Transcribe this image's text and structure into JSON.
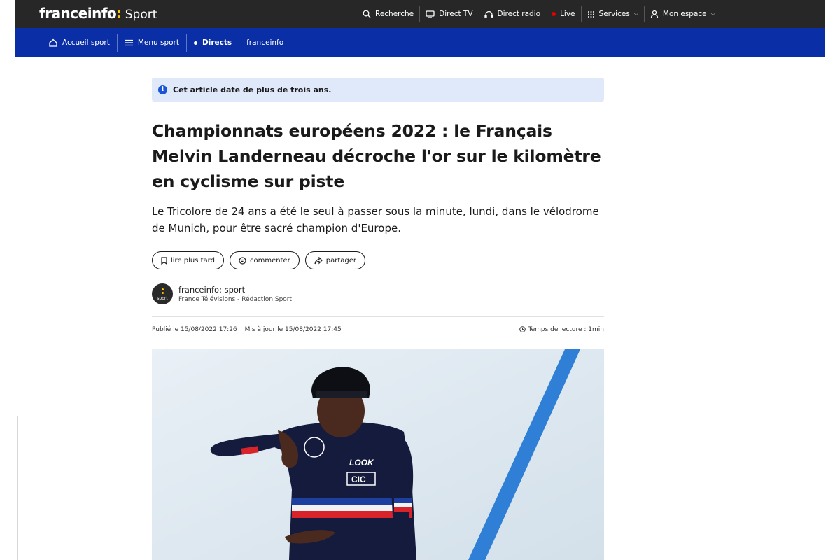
{
  "header": {
    "brand": "franceinfo",
    "brand_colon": ":",
    "section": "Sport",
    "nav": [
      {
        "label": "Recherche",
        "icon": "search-icon"
      },
      {
        "label": "Direct TV",
        "icon": "tv-icon"
      },
      {
        "label": "Direct radio",
        "icon": "headphones-icon"
      },
      {
        "label": "Live",
        "icon": "live-dot-icon"
      },
      {
        "label": "Services",
        "icon": "grid-icon"
      },
      {
        "label": "Mon espace",
        "icon": "user-icon"
      }
    ]
  },
  "subnav": {
    "items": [
      {
        "label": "Accueil sport",
        "icon": "home-icon"
      },
      {
        "label": "Menu sport",
        "icon": "menu-icon"
      },
      {
        "label": "Directs",
        "icon": "dot-icon"
      },
      {
        "label": "franceinfo"
      }
    ]
  },
  "notice": {
    "text": "Cet article date de plus de trois ans.",
    "icon": "info-icon"
  },
  "article": {
    "title": "Championnats européens 2022 : le Français Melvin Landerneau décroche l'or sur le kilomètre en cyclisme sur piste",
    "lead": "Le Tricolore de 24 ans a été le seul à passer sous la minute, lundi, dans le vélodrome de Munich, pour être sacré champion d'Europe.",
    "actions": [
      {
        "label": "lire plus tard",
        "icon": "bookmark-icon"
      },
      {
        "label": "commenter",
        "icon": "comment-icon"
      },
      {
        "label": "partager",
        "icon": "share-icon"
      }
    ],
    "author": {
      "name": "franceinfo: sport",
      "org": "France Télévisions - Rédaction Sport",
      "avatar_tag": "sport"
    },
    "published": "Publié le 15/08/2022 17:26",
    "updated": "Mis à jour le 15/08/2022 17:45",
    "reading_time": "Temps de lecture : 1min"
  },
  "photo": {
    "jersey_texts": [
      "LOOK",
      "CIC"
    ]
  },
  "colors": {
    "topbar": "#272727",
    "subbar": "#0a2ea5",
    "brand_accent": "#ffc800",
    "live": "#e20000",
    "notice_bg": "#dfe9fa"
  }
}
